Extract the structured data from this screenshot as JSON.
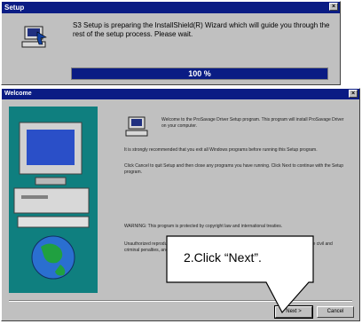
{
  "setup_window": {
    "title": "Setup",
    "close_glyph": "×",
    "message": "S3 Setup is preparing the InstallShield(R) Wizard which will guide you through the rest of the setup process. Please wait.",
    "progress_label": "100 %",
    "progress": 1.0
  },
  "welcome_window": {
    "title": "Welcome",
    "close_glyph": "×",
    "paragraphs": [
      "Welcome to the ProSavage Driver Setup program. This program will install ProSavage Driver on your computer.",
      "It is strongly recommended that you exit all Windows programs before running this Setup program.",
      "Click Cancel to quit Setup and then close any programs you have running. Click Next to continue with the Setup program.",
      "WARNING: This program is protected by copyright law and international treaties.",
      "Unauthorized reproduction or distribution of this program, or any portion of it, may result in severe civil and criminal penalties, and will be prosecuted to the maximum extent possible under law."
    ],
    "buttons": {
      "next": "Next >",
      "cancel": "Cancel"
    }
  },
  "callout": {
    "text": "2.Click “Next”."
  },
  "colors": {
    "title_bar": "#0a1c84",
    "face": "#c0c0c0",
    "art_bg": "#0f7f7f"
  },
  "icons": [
    "setup-computer-icon",
    "welcome-computer-icon",
    "close-icon"
  ]
}
